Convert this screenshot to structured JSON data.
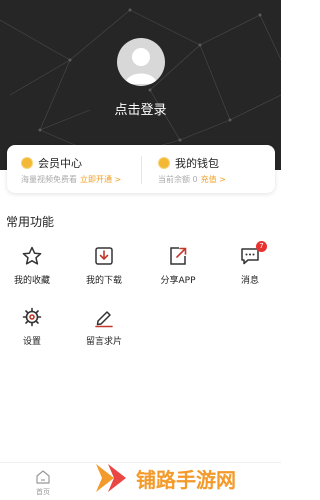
{
  "header": {
    "login_text": "点击登录"
  },
  "cards": {
    "vip": {
      "title": "会员中心",
      "subtitle": "海量视频免费看",
      "action": "立即开通 >"
    },
    "wallet": {
      "title": "我的钱包",
      "subtitle": "当前余额 0",
      "action": "充值 >"
    }
  },
  "functions": {
    "section_title": "常用功能",
    "items": [
      {
        "label": "我的收藏",
        "icon": "star-icon"
      },
      {
        "label": "我的下载",
        "icon": "download-icon"
      },
      {
        "label": "分享APP",
        "icon": "share-icon"
      },
      {
        "label": "消息",
        "icon": "message-icon",
        "badge": "7"
      },
      {
        "label": "设置",
        "icon": "gear-icon"
      },
      {
        "label": "留言求片",
        "icon": "pen-icon"
      }
    ]
  },
  "tabbar": {
    "home_label": "首页"
  },
  "watermark": {
    "text": "铺路手游网"
  },
  "colors": {
    "header_bg": "#262626",
    "accent": "#f0a020",
    "badge": "#e8322f",
    "watermark": "#f39a2a"
  }
}
